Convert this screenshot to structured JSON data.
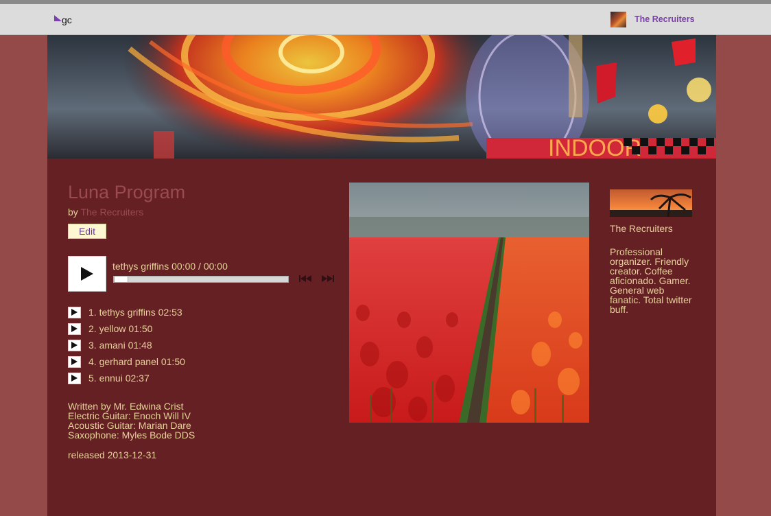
{
  "topbar": {
    "logo_text": "gc",
    "user_name": "The Recruiters"
  },
  "album": {
    "title": "Luna Program",
    "by_prefix": "by",
    "artist": "The Recruiters",
    "edit_label": "Edit"
  },
  "player": {
    "now_playing": "tethys griffins 00:00 / 00:00",
    "progress": 0
  },
  "tracks": [
    {
      "label": "1. tethys griffins 02:53"
    },
    {
      "label": "2. yellow 01:50"
    },
    {
      "label": "3. amani 01:48"
    },
    {
      "label": "4. gerhard panel 01:50"
    },
    {
      "label": "5. ennui 02:37"
    }
  ],
  "credits": [
    "Written by Mr. Edwina Crist",
    "Electric Guitar: Enoch Will IV",
    "Acoustic Guitar: Marian Dare",
    "Saxophone: Myles Bode DDS"
  ],
  "released": "released 2013-12-31",
  "sidebar": {
    "artist_name": "The Recruiters",
    "bio": "Professional organizer. Friendly creator. Coffee aficionado. Gamer. General web fanatic. Total twitter buff."
  },
  "colors": {
    "page_bg": "#954a4a",
    "content_bg": "#652024",
    "text": "#e7d29a",
    "link": "#9a4a50",
    "accent": "#7a3fa8"
  }
}
